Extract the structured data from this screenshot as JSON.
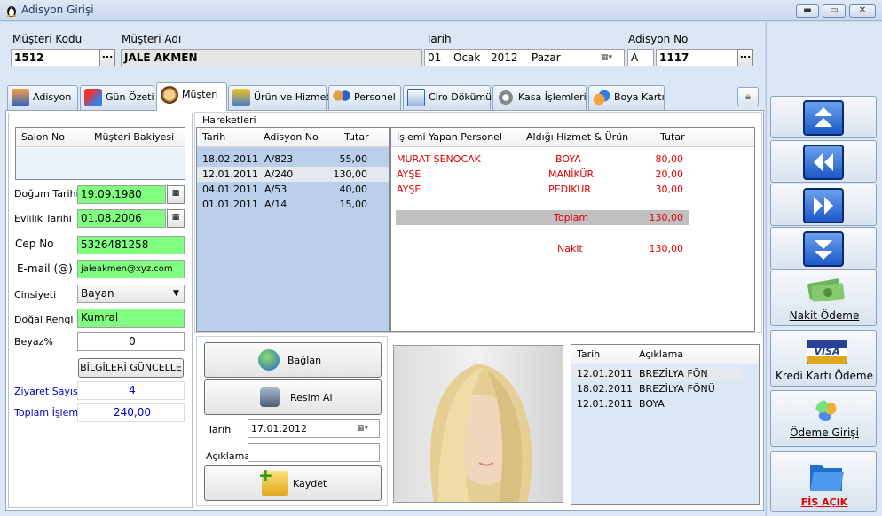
{
  "window": {
    "title": "Adisyon Girişi",
    "minimize": "▬",
    "maximize": "▭",
    "close": "✕"
  },
  "header": {
    "musteri_kodu_label": "Müşteri Kodu",
    "musteri_kodu": "1512",
    "musteri_adi_label": "Müşteri Adı",
    "musteri_adi": "JALE AKMEN",
    "tarih_label": "Tarih",
    "tarih_gun": "01",
    "tarih_ay": "Ocak",
    "tarih_yil": "2012",
    "tarih_haftagunu": "Pazar",
    "adisyon_no_label": "Adisyon No",
    "adisyon_seri": "A",
    "adisyon_no": "1117",
    "dots": "..."
  },
  "tabs": [
    "Adisyon",
    "Gün Özeti",
    "Müşteri",
    "Ürün ve Hizmet",
    "Personel",
    "Ciro Dökümü",
    "Kasa İşlemleri",
    "Boya Kartı"
  ],
  "left": {
    "salon_grid_headers": [
      "Salon No",
      "Müşteri Bakiyesi"
    ],
    "dogum_label": "Doğum Tarihi",
    "dogum": "19.09.1980",
    "evlilik_label": "Evlilik Tarihi",
    "evlilik": "01.08.2006",
    "cep_label": "Cep No",
    "cep": "5326481258",
    "email_label": "E-mail (@)",
    "email": "jaleakmen@xyz.com",
    "cinsiyet_label": "Cinsiyeti",
    "cinsiyet": "Bayan",
    "dogal_label": "Doğal Rengi",
    "dogal": "Kumral",
    "beyaz_label": "Beyaz%",
    "beyaz": "0",
    "guncelle": "BİLGİLERİ GÜNCELLE",
    "ziyaret_label": "Ziyaret Sayısı",
    "ziyaret": "4",
    "toplam_label": "Toplam İşlem",
    "toplam": "240,00"
  },
  "hareketler": {
    "title": "Hareketleri",
    "headers": [
      "Tarih",
      "Adisyon No",
      "Tutar"
    ],
    "rows": [
      [
        "18.02.2011",
        "A/823",
        "55,00"
      ],
      [
        "12.01.2011",
        "A/240",
        "130,00"
      ],
      [
        "04.01.2011",
        "A/53",
        "40,00"
      ],
      [
        "01.01.2011",
        "A/14",
        "15,00"
      ]
    ]
  },
  "detay": {
    "headers": [
      "İşlemi Yapan Personel",
      "Aldığı Hizmet & Ürün",
      "Tutar"
    ],
    "rows": [
      [
        "MURAT ŞENOCAK",
        "BOYA",
        "80,00"
      ],
      [
        "AYŞE",
        "MANİKÜR",
        "20,00"
      ],
      [
        "AYŞE",
        "PEDİKÜR",
        "30,00"
      ]
    ],
    "toplam_label": "Toplam",
    "toplam": "130,00",
    "nakit_label": "Nakit",
    "nakit": "130,00"
  },
  "resim": {
    "baglan": "Bağlan",
    "resim_al": "Resim Al",
    "tarih_label": "Tarih",
    "tarih": "17.01.2012",
    "aciklama_label": "Açıklama",
    "aciklama": "",
    "kaydet": "Kaydet"
  },
  "aciklamalar": {
    "headers": [
      "Tarih",
      "Açıklama"
    ],
    "rows": [
      [
        "12.01.2011",
        "BREZİLYA FÖN"
      ],
      [
        "18.02.2011",
        "BREZİLYA FÖNÜ"
      ],
      [
        "12.01.2011",
        "BOYA"
      ]
    ]
  },
  "right": {
    "nakit": "Nakit Ödeme",
    "kredi": "Kredi Kartı Ödeme",
    "odeme": "Ödeme Girişi",
    "fis": "FİŞ AÇIK",
    "visa": "VISA"
  },
  "colors": {
    "accent_green": "#80ff80",
    "red_text": "#e00000",
    "blue_label": "#0000c0",
    "grid_blue": "#b9cfea"
  }
}
